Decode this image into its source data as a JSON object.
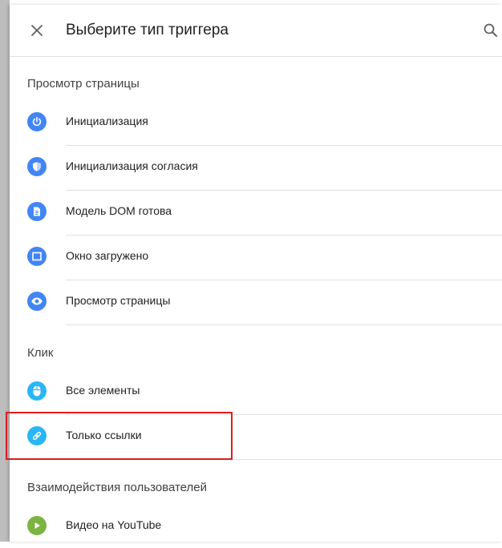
{
  "header": {
    "title": "Выберите тип триггера"
  },
  "sections": [
    {
      "label": "Просмотр страницы",
      "items": [
        {
          "label": "Инициализация",
          "icon": "power-icon",
          "color": "#4285f4"
        },
        {
          "label": "Инициализация согласия",
          "icon": "shield-icon",
          "color": "#4285f4"
        },
        {
          "label": "Модель DOM готова",
          "icon": "document-icon",
          "color": "#4285f4"
        },
        {
          "label": "Окно загружено",
          "icon": "window-icon",
          "color": "#4285f4"
        },
        {
          "label": "Просмотр страницы",
          "icon": "eye-icon",
          "color": "#4285f4"
        }
      ]
    },
    {
      "label": "Клик",
      "items": [
        {
          "label": "Все элементы",
          "icon": "mouse-icon",
          "color": "#29b6f6"
        },
        {
          "label": "Только ссылки",
          "icon": "link-icon",
          "color": "#29b6f6"
        }
      ]
    },
    {
      "label": "Взаимодействия пользователей",
      "items": [
        {
          "label": "Видео на YouTube",
          "icon": "play-icon",
          "color": "#7cb342"
        }
      ]
    }
  ],
  "highlight_color": "#e01b1b"
}
